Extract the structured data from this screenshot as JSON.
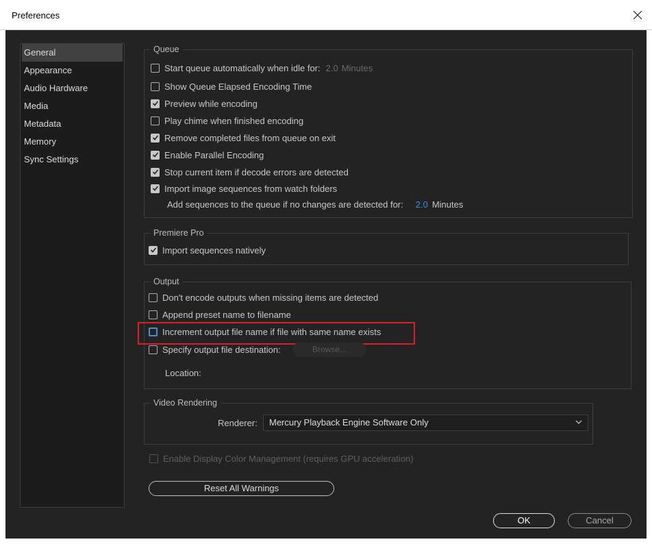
{
  "window": {
    "title": "Preferences"
  },
  "sidebar": {
    "items": [
      {
        "label": "General"
      },
      {
        "label": "Appearance"
      },
      {
        "label": "Audio Hardware"
      },
      {
        "label": "Media"
      },
      {
        "label": "Metadata"
      },
      {
        "label": "Memory"
      },
      {
        "label": "Sync Settings"
      }
    ],
    "selected": "General"
  },
  "queue": {
    "label": "Queue",
    "start_auto": {
      "label": "Start queue automatically when idle for:",
      "value": "2.0",
      "unit": "Minutes",
      "checked": false
    },
    "show_elapsed": {
      "label": "Show Queue Elapsed Encoding Time",
      "checked": false
    },
    "preview": {
      "label": "Preview while encoding",
      "checked": true
    },
    "chime": {
      "label": "Play chime when finished encoding",
      "checked": false
    },
    "remove_completed": {
      "label": "Remove completed files from queue on exit",
      "checked": true
    },
    "parallel": {
      "label": "Enable Parallel Encoding",
      "checked": true
    },
    "stop_on_errors": {
      "label": "Stop current item if decode errors are detected",
      "checked": true
    },
    "import_sequences": {
      "label": "Import image sequences from watch folders",
      "checked": true
    },
    "add_sequences": {
      "label": "Add sequences to the queue if no changes are detected for:",
      "value": "2.0",
      "unit": "Minutes"
    }
  },
  "premiere": {
    "label": "Premiere Pro",
    "import_natively": {
      "label": "Import sequences natively",
      "checked": true
    }
  },
  "output": {
    "label": "Output",
    "dont_encode": {
      "label": "Don't encode outputs when missing items are detected",
      "checked": false
    },
    "append_preset": {
      "label": "Append preset name to filename",
      "checked": false
    },
    "increment_name": {
      "label": "Increment output file name if file with same name exists",
      "checked": false
    },
    "specify_destination": {
      "label": "Specify output file destination:",
      "checked": false
    },
    "browse_label": "Browse...",
    "location_label": "Location:"
  },
  "video_rendering": {
    "label": "Video Rendering",
    "renderer_label": "Renderer:",
    "renderer_value": "Mercury Playback Engine Software Only"
  },
  "color_management": {
    "label": "Enable Display Color Management (requires GPU acceleration)",
    "checked": false
  },
  "buttons": {
    "reset_warnings": "Reset All Warnings",
    "ok": "OK",
    "cancel": "Cancel"
  },
  "colors": {
    "background": "#232323",
    "panel": "#1c1c1c",
    "accent_blue": "#3a8ee6",
    "highlight_red": "#dc1f26"
  }
}
